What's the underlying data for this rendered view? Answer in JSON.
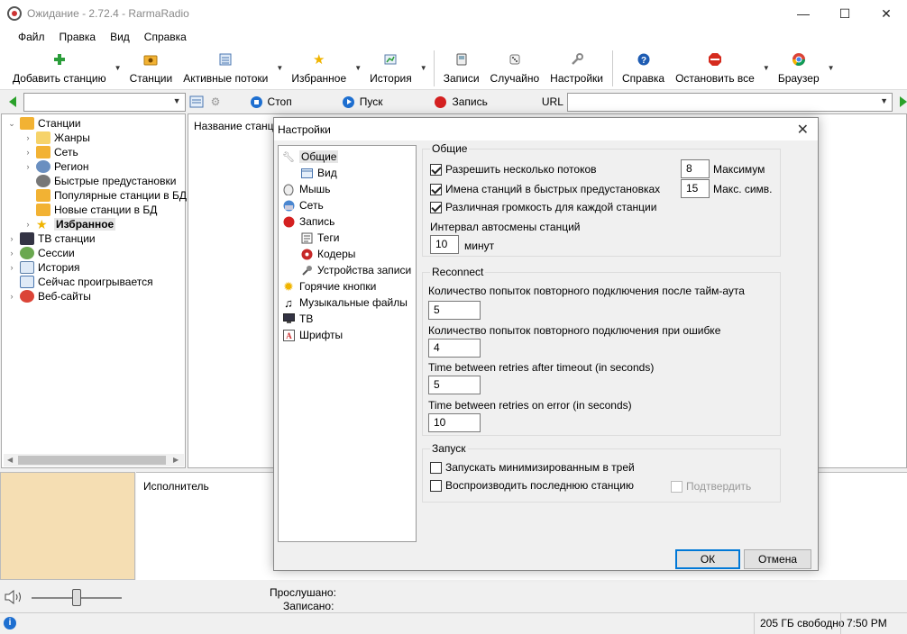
{
  "window": {
    "title": "Ожидание - 2.72.4 - RarmaRadio",
    "controls": [
      "—",
      "☐",
      "✕"
    ]
  },
  "menu": [
    "Файл",
    "Правка",
    "Вид",
    "Справка"
  ],
  "toolbar": [
    {
      "label": "Добавить станцию",
      "icon": "plus-icon",
      "arrow": true
    },
    {
      "label": "Станции",
      "icon": "folder-radio-icon",
      "arrow": false
    },
    {
      "label": "Активные потоки",
      "icon": "list-icon",
      "arrow": true
    },
    {
      "label": "Избранное",
      "icon": "star-icon",
      "arrow": true
    },
    {
      "label": "История",
      "icon": "history-icon",
      "arrow": true
    },
    {
      "label": "Записи",
      "icon": "device-icon",
      "arrow": false
    },
    {
      "label": "Случайно",
      "icon": "dice-icon",
      "arrow": false
    },
    {
      "label": "Настройки",
      "icon": "wrench-icon",
      "arrow": false
    },
    {
      "label": "Справка",
      "icon": "help-icon",
      "arrow": false
    },
    {
      "label": "Остановить все",
      "icon": "stop-sign-icon",
      "arrow": true
    },
    {
      "label": "Браузер",
      "icon": "chrome-icon",
      "arrow": true
    }
  ],
  "player": {
    "stop": "Стоп",
    "play": "Пуск",
    "record": "Запись",
    "url_label": "URL",
    "url_value": ""
  },
  "tree": [
    {
      "label": "Станции",
      "level": 0,
      "expander": "⌄"
    },
    {
      "label": "Жанры",
      "level": 1,
      "expander": "›"
    },
    {
      "label": "Сеть",
      "level": 1,
      "expander": "›"
    },
    {
      "label": "Регион",
      "level": 1,
      "expander": "›"
    },
    {
      "label": "Быстрые предустановки",
      "level": 1,
      "expander": ""
    },
    {
      "label": "Популярные станции в БД",
      "level": 1,
      "expander": ""
    },
    {
      "label": "Новые станции в БД",
      "level": 1,
      "expander": ""
    },
    {
      "label": "Избранное",
      "level": 1,
      "expander": "›",
      "selected": true
    },
    {
      "label": "ТВ станции",
      "level": 0,
      "expander": "›"
    },
    {
      "label": "Сессии",
      "level": 0,
      "expander": "›"
    },
    {
      "label": "История",
      "level": 0,
      "expander": "›"
    },
    {
      "label": "Сейчас проигрывается",
      "level": 0,
      "expander": ""
    },
    {
      "label": "Веб-сайты",
      "level": 0,
      "expander": "›"
    }
  ],
  "main": {
    "column_header": "Название станци"
  },
  "info": {
    "artist_label": "Исполнитель",
    "listened_label": "Прослушано:",
    "recorded_label": "Записано:"
  },
  "status": {
    "free_space": "205 ГБ свободно",
    "time": "7:50 PM"
  },
  "dialog": {
    "title": "Настройки",
    "close": "✕",
    "nav": [
      {
        "label": "Общие",
        "level": 0,
        "selected": true
      },
      {
        "label": "Вид",
        "level": 1
      },
      {
        "label": "Мышь",
        "level": 0
      },
      {
        "label": "Сеть",
        "level": 0
      },
      {
        "label": "Запись",
        "level": 0
      },
      {
        "label": "Теги",
        "level": 1
      },
      {
        "label": "Кодеры",
        "level": 1
      },
      {
        "label": "Устройства записи",
        "level": 1
      },
      {
        "label": "Горячие кнопки",
        "level": 0
      },
      {
        "label": "Музыкальные файлы",
        "level": 0
      },
      {
        "label": "ТВ",
        "level": 0
      },
      {
        "label": "Шрифты",
        "level": 0
      }
    ],
    "general": {
      "title": "Общие",
      "multi_streams": "Разрешить несколько потоков",
      "multi_streams_checked": true,
      "max_label": "Максимум",
      "max_value": "8",
      "station_names": "Имена станций в быстрых предустановках",
      "station_names_checked": true,
      "max_chars_label": "Макс. симв.",
      "max_chars_value": "15",
      "volume_per_station": "Различная громкость для каждой станции",
      "volume_per_station_checked": true,
      "interval_label": "Интервал автосмены станций",
      "interval_value": "10",
      "interval_unit": "минут"
    },
    "reconnect": {
      "title": "Reconnect",
      "retries_timeout_label": "Количество попыток повторного подключения после тайм-аута",
      "retries_timeout_value": "5",
      "retries_error_label": "Количество попыток повторного подключения при ошибке",
      "retries_error_value": "4",
      "time_timeout_label": "Time between retries after timeout (in seconds)",
      "time_timeout_value": "5",
      "time_error_label": "Time between retries on error (in seconds)",
      "time_error_value": "10"
    },
    "startup": {
      "title": "Запуск",
      "minimized": "Запускать минимизированным в трей",
      "minimized_checked": false,
      "play_last": "Воспроизводить последнюю станцию",
      "play_last_checked": false,
      "confirm": "Подтвердить",
      "confirm_checked": false
    },
    "ok": "ОК",
    "cancel": "Отмена"
  }
}
